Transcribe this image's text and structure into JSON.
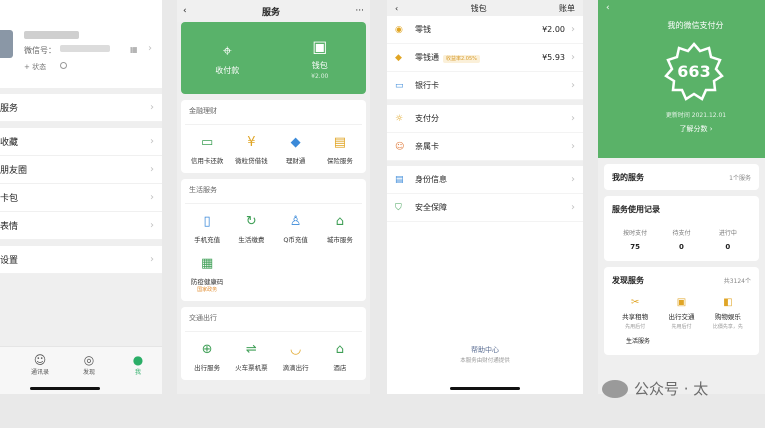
{
  "panel1": {
    "wechat_id_label": "微信号：",
    "status_label": "+ 状态",
    "menu": [
      "服务",
      "收藏",
      "朋友圈",
      "卡包",
      "表情",
      "设置"
    ],
    "tabs": [
      "通讯录",
      "发现",
      "我"
    ]
  },
  "panel2": {
    "title": "服务",
    "more": "···",
    "hero": [
      {
        "label": "收付款",
        "sub": ""
      },
      {
        "label": "钱包",
        "sub": "¥2.00"
      }
    ],
    "sections": [
      {
        "title": "金融理财",
        "items": [
          {
            "label": "信用卡还款",
            "icon": "credit-card-icon",
            "sub": ""
          },
          {
            "label": "微粒贷借钱",
            "icon": "loan-icon",
            "sub": ""
          },
          {
            "label": "理财通",
            "icon": "wealth-icon",
            "sub": ""
          },
          {
            "label": "保险服务",
            "icon": "insurance-icon",
            "sub": ""
          }
        ]
      },
      {
        "title": "生活服务",
        "items": [
          {
            "label": "手机充值",
            "icon": "phone-icon",
            "sub": ""
          },
          {
            "label": "生活缴费",
            "icon": "bill-icon",
            "sub": ""
          },
          {
            "label": "Q币充值",
            "icon": "qq-icon",
            "sub": ""
          },
          {
            "label": "城市服务",
            "icon": "city-icon",
            "sub": ""
          },
          {
            "label": "防疫健康码",
            "icon": "qr-code-icon",
            "sub": "国家政务"
          }
        ]
      },
      {
        "title": "交通出行",
        "items": [
          {
            "label": "出行服务",
            "icon": "travel-icon",
            "sub": ""
          },
          {
            "label": "火车票机票",
            "icon": "train-icon",
            "sub": ""
          },
          {
            "label": "滴滴出行",
            "icon": "didi-icon",
            "sub": ""
          },
          {
            "label": "酒店",
            "icon": "hotel-icon",
            "sub": ""
          }
        ]
      }
    ]
  },
  "panel3": {
    "title": "钱包",
    "bill": "账单",
    "groups": [
      [
        {
          "label": "零钱",
          "value": "¥2.00",
          "badge": "",
          "icon": "coin-icon"
        },
        {
          "label": "零钱通",
          "value": "¥5.93",
          "badge": "收益率2.05%",
          "icon": "diamond-icon"
        },
        {
          "label": "银行卡",
          "value": "",
          "badge": "",
          "icon": "bank-card-icon"
        }
      ],
      [
        {
          "label": "支付分",
          "value": "",
          "badge": "",
          "icon": "score-icon"
        },
        {
          "label": "亲属卡",
          "value": "",
          "badge": "",
          "icon": "family-card-icon"
        }
      ],
      [
        {
          "label": "身份信息",
          "value": "",
          "badge": "",
          "icon": "id-card-icon"
        },
        {
          "label": "安全保障",
          "value": "",
          "badge": "",
          "icon": "shield-icon"
        }
      ]
    ],
    "help": "帮助中心",
    "footer": "本服务由财付通提供"
  },
  "panel4": {
    "title": "我的微信支付分",
    "score": "663",
    "updated": "更新时间 2021.12.01",
    "learn_more": "了解分数 ›",
    "my_services": "我的服务",
    "my_services_count": "1个服务",
    "records_title": "服务使用记录",
    "stats": [
      {
        "label": "按时支付",
        "value": "75"
      },
      {
        "label": "待支付",
        "value": "0"
      },
      {
        "label": "进行中",
        "value": "0"
      }
    ],
    "discover_title": "发现服务",
    "discover_count": "共3124个",
    "discover": [
      {
        "label": "共享租物",
        "sub": "先用后付",
        "icon": "rent-icon"
      },
      {
        "label": "出行交通",
        "sub": "先用后付",
        "icon": "bus-icon"
      },
      {
        "label": "购物娱乐",
        "sub": "比價先享，先",
        "icon": "shopping-icon"
      }
    ],
    "more_label": "生活服务"
  },
  "watermark": "公众号 · 太"
}
